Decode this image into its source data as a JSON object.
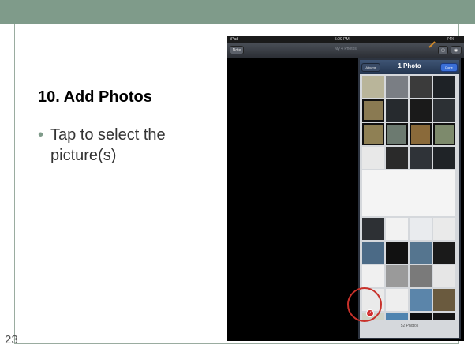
{
  "slide": {
    "title": "10. Add Photos",
    "bullet_char": "•",
    "bullet": "Tap to select the picture(s)",
    "number": "23"
  },
  "ipad": {
    "status": {
      "carrier": "iPad",
      "time": "5:09 PM",
      "battery": "74%"
    },
    "nav": {
      "left_button": "Note",
      "title": "My 4 Photos"
    },
    "popover": {
      "albums_button": "Albums",
      "title": "1 Photo",
      "done_button": "Done",
      "footer": "52 Photos"
    },
    "check_mark": "✓"
  },
  "colors": {
    "accent": "#7f9b8a",
    "selection_circle": "#c8312a"
  }
}
